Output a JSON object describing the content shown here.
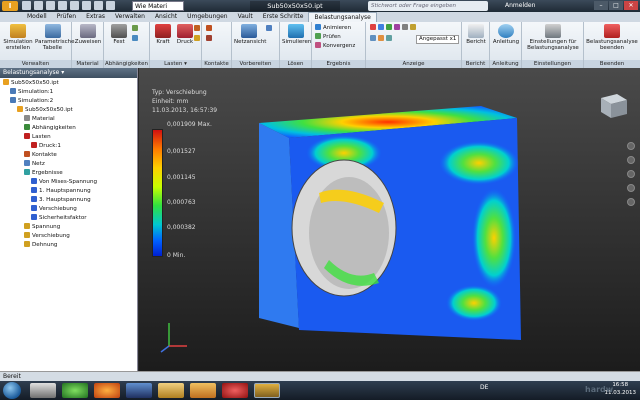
{
  "titlebar": {
    "logo": "I",
    "material_value": "Wie Materi",
    "window_title": "Sub50x50x50.ipt",
    "search_placeholder": "Stichwort oder Frage eingeben",
    "login": "Anmelden",
    "min": "–",
    "max": "□",
    "close": "✕"
  },
  "tabs": [
    "Modell",
    "Prüfen",
    "Extras",
    "Verwalten",
    "Ansicht",
    "Umgebungen",
    "Vault",
    "Erste Schritte",
    "Belastungsanalyse"
  ],
  "active_tab": "Belastungsanalyse",
  "ribbon": {
    "groups": [
      "Verwalten",
      "Material",
      "Abhängigkeiten",
      "Lasten",
      "Kontakte",
      "Vorbereiten",
      "Lösen",
      "Ergebnis",
      "Anzeige",
      "Bericht",
      "Anleitung",
      "Einstellungen",
      "Beenden"
    ],
    "lasten_arrow": "Lasten ▾",
    "buttons": {
      "simulation": "Simulation erstellen",
      "param_table": "Parametrische Tabelle",
      "assign": "Zuweisen",
      "fixed": "Fest",
      "force": "Kraft",
      "pressure": "Druck",
      "mesh_view": "Netzansicht",
      "simulate": "Simulieren",
      "animate": "Animieren",
      "check": "Prüfen",
      "convergence": "Konvergenz",
      "fit": "Angepasst x1",
      "report": "Bericht",
      "guide": "Anleitung",
      "settings": "Einstellungen für Belastungsanalyse",
      "finish": "Belastungsanalyse beenden"
    }
  },
  "sidebar": {
    "header": "Belastungsanalyse ▾",
    "nodes": [
      {
        "label": "Sub50x50x50.ipt",
        "indent": 0,
        "color": "#e8a020"
      },
      {
        "label": "Simulation:1",
        "indent": 1,
        "color": "#4a7ab8"
      },
      {
        "label": "Simulation:2",
        "indent": 1,
        "color": "#4a7ab8"
      },
      {
        "label": "Sub50x50x50.ipt",
        "indent": 2,
        "color": "#e8a020"
      },
      {
        "label": "Material",
        "indent": 3,
        "color": "#8a8a8a"
      },
      {
        "label": "Abhängigkeiten",
        "indent": 3,
        "color": "#3a8a3a"
      },
      {
        "label": "Lasten",
        "indent": 3,
        "color": "#c02020"
      },
      {
        "label": "Druck:1",
        "indent": 4,
        "color": "#c02020"
      },
      {
        "label": "Kontakte",
        "indent": 3,
        "color": "#c05020"
      },
      {
        "label": "Netz",
        "indent": 3,
        "color": "#5080c0"
      },
      {
        "label": "Ergebnisse",
        "indent": 3,
        "color": "#30a0a0"
      },
      {
        "label": "Von Mises-Spannung",
        "indent": 4,
        "color": "#3060d0"
      },
      {
        "label": "1. Hauptspannung",
        "indent": 4,
        "color": "#3060d0"
      },
      {
        "label": "3. Hauptspannung",
        "indent": 4,
        "color": "#3060d0"
      },
      {
        "label": "Verschiebung",
        "indent": 4,
        "color": "#3060d0"
      },
      {
        "label": "Sicherheitsfaktor",
        "indent": 4,
        "color": "#3060d0"
      },
      {
        "label": "Spannung",
        "indent": 3,
        "color": "#d0a020"
      },
      {
        "label": "Verschiebung",
        "indent": 3,
        "color": "#d0a020"
      },
      {
        "label": "Dehnung",
        "indent": 3,
        "color": "#d0a020"
      }
    ]
  },
  "legend": {
    "type": "Typ: Verschiebung",
    "unit": "Einheit: mm",
    "date": "11.03.2013, 16:57:39",
    "max": "0,001909 Max.",
    "v1": "0,001527",
    "v2": "0,001145",
    "v3": "0,000763",
    "v4": "0,000382",
    "min": "0 Min."
  },
  "statusbar": {
    "text": "Bereit"
  },
  "taskbar": {
    "lang": "DE",
    "time": "16:58",
    "date": "11.03.2013"
  },
  "watermark": "hardw"
}
